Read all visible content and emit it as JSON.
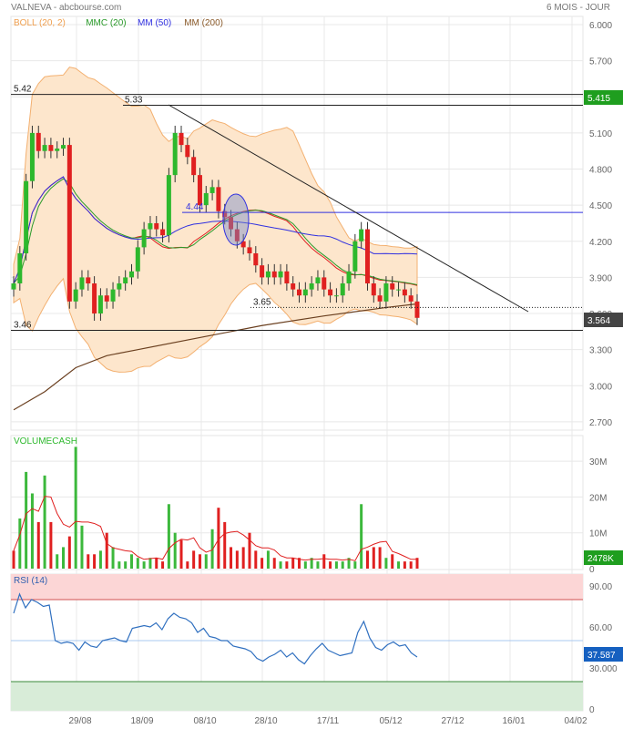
{
  "header": {
    "title": "VALNEVA - abcbourse.com",
    "period": "6 MOIS - JOUR"
  },
  "legend": [
    {
      "label": "BOLL (20, 2)",
      "color": "#f0a050"
    },
    {
      "label": "MMC (20)",
      "color": "#2a9a2a"
    },
    {
      "label": "MM (50)",
      "color": "#3030e0"
    },
    {
      "label": "MM (200)",
      "color": "#8a5a2a"
    }
  ],
  "chart_data": [
    {
      "type": "candlestick",
      "title": "VALNEVA",
      "ylim": [
        2.7,
        6.0
      ],
      "yticks": [
        "6.000",
        "5.700",
        "5.400",
        "5.100",
        "4.800",
        "4.500",
        "4.200",
        "3.900",
        "3.600",
        "3.300",
        "3.000",
        "2.700"
      ],
      "xticks": [
        "29/08",
        "18/09",
        "08/10",
        "28/10",
        "17/11",
        "05/12",
        "27/12",
        "16/01",
        "04/02"
      ],
      "closes": [
        3.85,
        4.1,
        4.7,
        5.1,
        4.95,
        5.0,
        4.95,
        4.97,
        5.0,
        3.7,
        3.8,
        3.9,
        3.85,
        3.6,
        3.75,
        3.7,
        3.8,
        3.85,
        3.9,
        3.95,
        4.15,
        4.3,
        4.35,
        4.3,
        4.25,
        4.75,
        5.1,
        5.0,
        4.9,
        4.75,
        4.5,
        4.6,
        4.65,
        4.45,
        4.4,
        4.3,
        4.2,
        4.15,
        4.1,
        4.0,
        3.9,
        3.95,
        3.9,
        3.95,
        3.85,
        3.8,
        3.75,
        3.8,
        3.85,
        3.9,
        3.8,
        3.75,
        3.75,
        3.85,
        3.95,
        4.2,
        4.3,
        3.85,
        3.75,
        3.7,
        3.85,
        3.8,
        3.8,
        3.75,
        3.7,
        3.564
      ],
      "mm200": [
        [
          0,
          2.8
        ],
        [
          5,
          2.95
        ],
        [
          10,
          3.15
        ],
        [
          15,
          3.25
        ],
        [
          20,
          3.3
        ],
        [
          30,
          3.4
        ],
        [
          40,
          3.5
        ],
        [
          50,
          3.58
        ],
        [
          60,
          3.65
        ],
        [
          65,
          3.68
        ]
      ],
      "levels": [
        {
          "label": "5.42",
          "value": 5.42
        },
        {
          "label": "5.33",
          "value": 5.33
        },
        {
          "label": "4.44",
          "value": 4.44
        },
        {
          "label": "3.65",
          "value": 3.65
        },
        {
          "label": "3.46",
          "value": 3.46
        }
      ],
      "last_price": "5.415",
      "current_price": "3.564"
    },
    {
      "type": "bar",
      "title": "VOLUMECASH",
      "ylim": [
        0,
        35
      ],
      "yticks": [
        "30M",
        "20M",
        "10M",
        "0"
      ],
      "unit": "M",
      "values": [
        5,
        14,
        27,
        21,
        13,
        26,
        13,
        4,
        6,
        9,
        34,
        12,
        4,
        4,
        5,
        10,
        6,
        2,
        2,
        4,
        3,
        2,
        3,
        3,
        2,
        18,
        10,
        8,
        2,
        5,
        4,
        4,
        11,
        17,
        13,
        6,
        5,
        6,
        10,
        5,
        3,
        5,
        3,
        2,
        2,
        3,
        3,
        2,
        3,
        2,
        4,
        2,
        2,
        2,
        3,
        2,
        18,
        5,
        6,
        6,
        3,
        4,
        2,
        2,
        2,
        3
      ],
      "last": "2478K"
    },
    {
      "type": "line",
      "title": "RSI (14)",
      "ylim": [
        0,
        100
      ],
      "yticks": [
        "90.00",
        "60.00",
        "30.000",
        "0"
      ],
      "values": [
        70,
        84,
        74,
        80,
        78,
        75,
        76,
        50,
        48,
        49,
        48,
        43,
        49,
        46,
        45,
        50,
        51,
        52,
        50,
        49,
        59,
        60,
        61,
        60,
        63,
        58,
        66,
        70,
        67,
        66,
        63,
        56,
        59,
        53,
        52,
        50,
        50,
        46,
        45,
        44,
        42,
        37,
        35,
        38,
        40,
        43,
        38,
        41,
        36,
        33,
        39,
        44,
        48,
        43,
        41,
        39,
        40,
        41,
        56,
        64,
        52,
        45,
        43,
        47,
        49,
        46,
        47,
        41,
        38
      ],
      "last": "37.587",
      "overbought": 80,
      "oversold": 20,
      "mid": 50
    }
  ]
}
